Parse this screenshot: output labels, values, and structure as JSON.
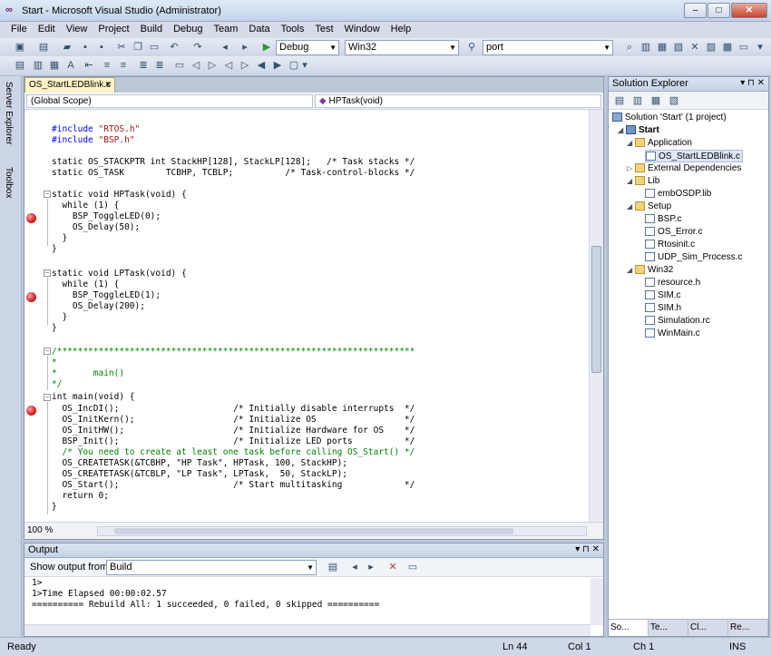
{
  "window": {
    "title": "Start - Microsoft Visual Studio (Administrator)",
    "min": "‒",
    "max": "□",
    "close": "✕"
  },
  "menu": [
    "File",
    "Edit",
    "View",
    "Project",
    "Build",
    "Debug",
    "Team",
    "Data",
    "Tools",
    "Test",
    "Window",
    "Help"
  ],
  "toolbar": {
    "config": "Debug",
    "platform": "Win32",
    "find": "port"
  },
  "sidebar": {
    "server_explorer": "Server Explorer",
    "toolbox": "Toolbox"
  },
  "editor": {
    "tab": "OS_StartLEDBlink.c",
    "scope_left": "(Global Scope)",
    "scope_right": "HPTask(void)",
    "zoom": "100 %"
  },
  "code_lines": [
    "",
    "#include \"RTOS.h\"",
    "#include \"BSP.h\"",
    "",
    "static OS_STACKPTR int StackHP[128], StackLP[128];   /* Task stacks */",
    "static OS_TASK        TCBHP, TCBLP;          /* Task-control-blocks */",
    "",
    "static void HPTask(void) {",
    "  while (1) {",
    "    BSP_ToggleLED(0);",
    "    OS_Delay(50);",
    "  }",
    "}",
    "",
    "static void LPTask(void) {",
    "  while (1) {",
    "    BSP_ToggleLED(1);",
    "    OS_Delay(200);",
    "  }",
    "}",
    "",
    "/*********************************************************************",
    "*",
    "*       main()",
    "*/",
    "int main(void) {",
    "  OS_IncDI();                      /* Initially disable interrupts  */",
    "  OS_InitKern();                   /* Initialize OS                 */",
    "  OS_InitHW();                     /* Initialize Hardware for OS    */",
    "  BSP_Init();                      /* Initialize LED ports          */",
    "  /* You need to create at least one task before calling OS_Start() */",
    "  OS_CREATETASK(&TCBHP, \"HP Task\", HPTask, 100, StackHP);",
    "  OS_CREATETASK(&TCBLP, \"LP Task\", LPTask,  50, StackLP);",
    "  OS_Start();                      /* Start multitasking            */",
    "  return 0;",
    "}"
  ],
  "solution": {
    "title": "Solution Explorer",
    "nodes": [
      "Solution 'Start' (1 project)",
      "Start",
      "Application",
      "OS_StartLEDBlink.c",
      "External Dependencies",
      "Lib",
      "embOSDP.lib",
      "Setup",
      "BSP.c",
      "OS_Error.c",
      "Rtosinit.c",
      "UDP_Sim_Process.c",
      "Win32",
      "resource.h",
      "SIM.c",
      "SIM.h",
      "Simulation.rc",
      "WinMain.c"
    ],
    "tabs": [
      "So...",
      "Te...",
      "Cl...",
      "Re..."
    ]
  },
  "output": {
    "title": "Output",
    "show_from_label": "Show output from:",
    "show_from_value": "Build",
    "lines": [
      "1>",
      "1>Time Elapsed 00:00:02.57",
      "========== Rebuild All: 1 succeeded, 0 failed, 0 skipped =========="
    ]
  },
  "status": {
    "ready": "Ready",
    "ln": "Ln 44",
    "col": "Col 1",
    "ch": "Ch 1",
    "ins": "INS"
  }
}
